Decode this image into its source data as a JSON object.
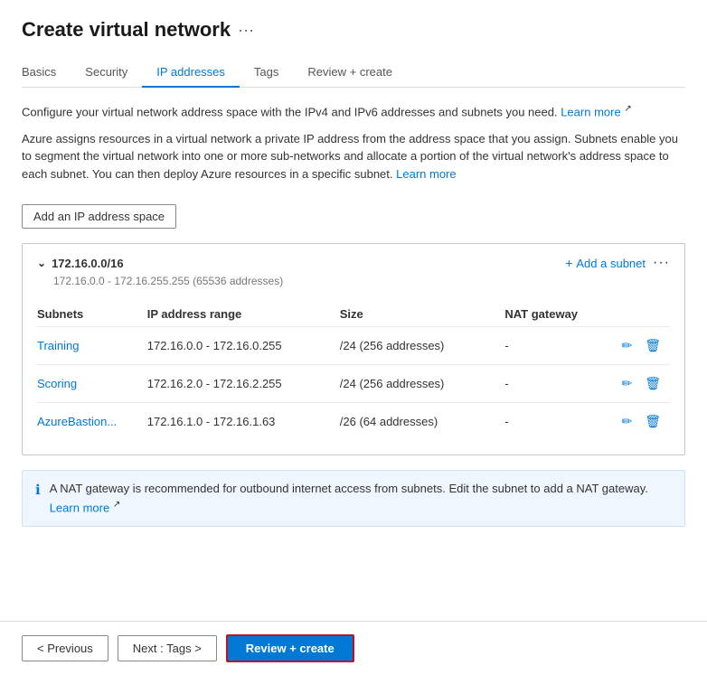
{
  "page": {
    "title": "Create virtual network",
    "ellipsis": "···"
  },
  "tabs": [
    {
      "id": "basics",
      "label": "Basics",
      "active": false
    },
    {
      "id": "security",
      "label": "Security",
      "active": false
    },
    {
      "id": "ip-addresses",
      "label": "IP addresses",
      "active": true
    },
    {
      "id": "tags",
      "label": "Tags",
      "active": false
    },
    {
      "id": "review-create",
      "label": "Review + create",
      "active": false
    }
  ],
  "info": {
    "line1": "Configure your virtual network address space with the IPv4 and IPv6 addresses and subnets you need.",
    "learn_more_1": "Learn more",
    "line2": "Azure assigns resources in a virtual network a private IP address from the address space that you assign. Subnets enable you to segment the virtual network into one or more sub-networks and allocate a portion of the virtual network's address space to each subnet. You can then deploy Azure resources in a specific subnet.",
    "learn_more_2": "Learn more"
  },
  "add_ip_button": "Add an IP address space",
  "ip_space": {
    "cidr": "172.16.0.0/16",
    "range_label": "172.16.0.0 - 172.16.255.255 (65536 addresses)",
    "add_subnet_label": "Add a subnet",
    "more_icon": "···"
  },
  "subnet_table": {
    "headers": [
      "Subnets",
      "IP address range",
      "Size",
      "NAT gateway"
    ],
    "rows": [
      {
        "name": "Training",
        "ip_range": "172.16.0.0 - 172.16.0.255",
        "size": "/24 (256 addresses)",
        "nat": "-"
      },
      {
        "name": "Scoring",
        "ip_range": "172.16.2.0 - 172.16.2.255",
        "size": "/24 (256 addresses)",
        "nat": "-"
      },
      {
        "name": "AzureBastion...",
        "ip_range": "172.16.1.0 - 172.16.1.63",
        "size": "/26 (64 addresses)",
        "nat": "-"
      }
    ]
  },
  "nat_notice": {
    "text": "A NAT gateway is recommended for outbound internet access from subnets. Edit the subnet to add a NAT gateway.",
    "learn_more": "Learn more"
  },
  "footer": {
    "previous_label": "< Previous",
    "next_label": "Next : Tags >",
    "review_label": "Review + create"
  }
}
